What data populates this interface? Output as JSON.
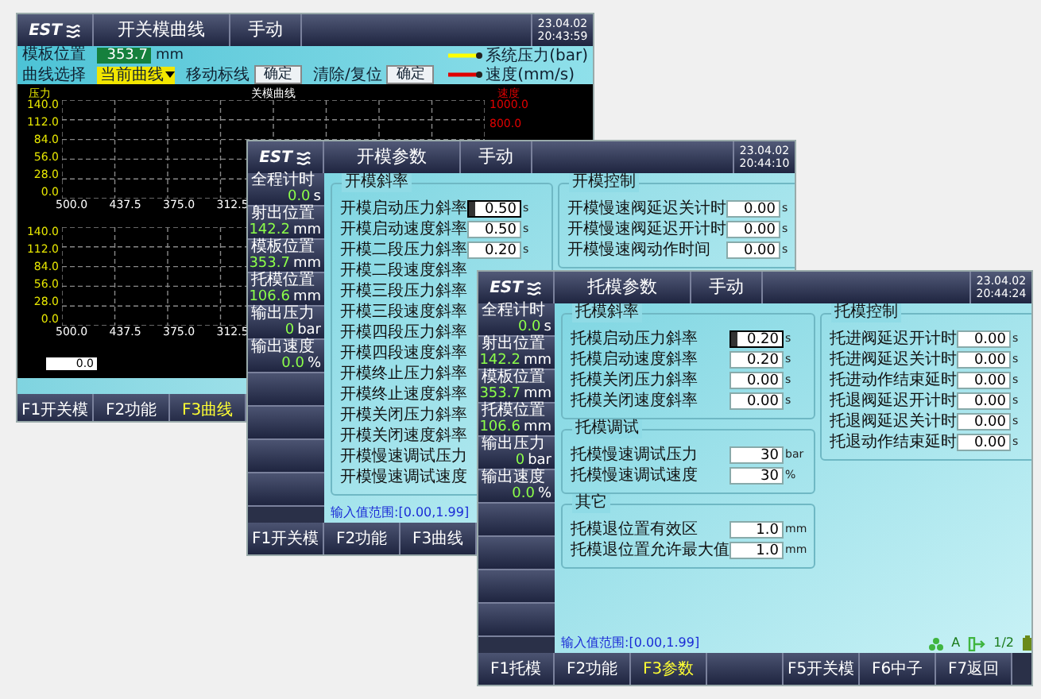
{
  "screens": [
    {
      "kind": "curve",
      "header": {
        "logo": "EST",
        "title": "开关模曲线",
        "mode": "手动",
        "date": "23.04.02",
        "time": "20:43:59"
      },
      "info": {
        "position_label": "模板位置",
        "position_value": "353.7",
        "position_unit": "mm",
        "curve_label": "曲线选择",
        "curve_select": "当前曲线",
        "move_label": "移动标线",
        "move_button": "确定",
        "clear_label": "清除/复位",
        "clear_button": "确定"
      },
      "legend": [
        {
          "label": "系统压力(bar)",
          "color": "#ffff00"
        },
        {
          "label": "速度(mm/s)",
          "color": "#e00000"
        }
      ],
      "charts": [
        {
          "title": "关模曲线",
          "left_axis": "压力",
          "right_axis": "速度",
          "yticks": [
            "140.0",
            "112.0",
            "84.0",
            "56.0",
            "28.0",
            "0.0"
          ],
          "right_ticks": [
            "1000.0",
            "800.0"
          ],
          "xticks": [
            "500.0",
            "437.5",
            "375.0",
            "312.5"
          ]
        },
        {
          "yticks": [
            "140.0",
            "112.0",
            "84.0",
            "56.0",
            "28.0",
            "0.0"
          ],
          "xticks": [
            "500.0",
            "437.5",
            "375.0",
            "312.5"
          ]
        }
      ],
      "cursor_value": "0.0",
      "buttons": [
        {
          "kind": "key",
          "label": "F1开关模",
          "selected": false
        },
        {
          "kind": "key",
          "label": "F2功能",
          "selected": false
        },
        {
          "kind": "key",
          "label": "F3曲线",
          "selected": true
        }
      ]
    },
    {
      "kind": "params",
      "header": {
        "logo": "EST",
        "title": "开模参数",
        "mode": "手动",
        "date": "23.04.02",
        "time": "20:44:10"
      },
      "status": [
        {
          "label": "全程计时",
          "value": "0.0",
          "unit": "s"
        },
        {
          "label": "射出位置",
          "value": "142.2",
          "unit": "mm"
        },
        {
          "label": "模板位置",
          "value": "353.7",
          "unit": "mm"
        },
        {
          "label": "托模位置",
          "value": "106.6",
          "unit": "mm"
        },
        {
          "label": "输出压力",
          "value": "0",
          "unit": "bar"
        },
        {
          "label": "输出速度",
          "value": "0.0",
          "unit": "%"
        }
      ],
      "columns": [
        [
          {
            "title": "开模斜率",
            "rows": [
              {
                "label": "开模启动压力斜率",
                "value": "0.50",
                "unit": "s",
                "focused": true
              },
              {
                "label": "开模启动速度斜率",
                "value": "0.50",
                "unit": "s",
                "focused": false
              },
              {
                "label": "开模二段压力斜率",
                "value": "0.20",
                "unit": "s",
                "focused": false
              },
              {
                "label": "开模二段速度斜率"
              },
              {
                "label": "开模三段压力斜率"
              },
              {
                "label": "开模三段速度斜率"
              },
              {
                "label": "开模四段压力斜率"
              },
              {
                "label": "开模四段速度斜率"
              },
              {
                "label": "开模终止压力斜率"
              },
              {
                "label": "开模终止速度斜率"
              },
              {
                "label": "开模关闭压力斜率"
              },
              {
                "label": "开模关闭速度斜率"
              },
              {
                "label": "开模慢速调试压力"
              },
              {
                "label": "开模慢速调试速度"
              }
            ]
          }
        ],
        [
          {
            "title": "开模控制",
            "rows": [
              {
                "label": "开模慢速阀延迟关计时",
                "value": "0.00",
                "unit": "s",
                "focused": false
              },
              {
                "label": "开模慢速阀延迟开计时",
                "value": "0.00",
                "unit": "s",
                "focused": false
              },
              {
                "label": "开模慢速阀动作时间",
                "value": "0.00",
                "unit": "s",
                "focused": false
              }
            ]
          }
        ]
      ],
      "range": "输入值范围:[0.00,1.99]",
      "buttons": [
        {
          "kind": "key",
          "label": "F1开关模",
          "selected": false
        },
        {
          "kind": "key",
          "label": "F2功能",
          "selected": false
        },
        {
          "kind": "key",
          "label": "F3曲线",
          "selected": false
        }
      ]
    },
    {
      "kind": "params",
      "header": {
        "logo": "EST",
        "title": "托模参数",
        "mode": "手动",
        "date": "23.04.02",
        "time": "20:44:24"
      },
      "status": [
        {
          "label": "全程计时",
          "value": "0.0",
          "unit": "s"
        },
        {
          "label": "射出位置",
          "value": "142.2",
          "unit": "mm"
        },
        {
          "label": "模板位置",
          "value": "353.7",
          "unit": "mm"
        },
        {
          "label": "托模位置",
          "value": "106.6",
          "unit": "mm"
        },
        {
          "label": "输出压力",
          "value": "0",
          "unit": "bar"
        },
        {
          "label": "输出速度",
          "value": "0.0",
          "unit": "%"
        }
      ],
      "columns": [
        [
          {
            "title": "托模斜率",
            "rows": [
              {
                "label": "托模启动压力斜率",
                "value": "0.20",
                "unit": "s",
                "focused": true
              },
              {
                "label": "托模启动速度斜率",
                "value": "0.20",
                "unit": "s",
                "focused": false
              },
              {
                "label": "托模关闭压力斜率",
                "value": "0.00",
                "unit": "s",
                "focused": false
              },
              {
                "label": "托模关闭速度斜率",
                "value": "0.00",
                "unit": "s",
                "focused": false
              }
            ]
          },
          {
            "title": "托模调试",
            "rows": [
              {
                "label": "托模慢速调试压力",
                "value": "30",
                "unit": "bar",
                "focused": false
              },
              {
                "label": "托模慢速调试速度",
                "value": "30",
                "unit": "%",
                "focused": false
              }
            ]
          },
          {
            "title": "其它",
            "rows": [
              {
                "label": "托模退位置有效区",
                "value": "1.0",
                "unit": "mm",
                "focused": false
              },
              {
                "label": "托模退位置允许最大值",
                "value": "1.0",
                "unit": "mm",
                "focused": false
              }
            ]
          }
        ],
        [
          {
            "title": "托模控制",
            "rows": [
              {
                "label": "托进阀延迟开计时",
                "value": "0.00",
                "unit": "s",
                "focused": false
              },
              {
                "label": "托进阀延迟关计时",
                "value": "0.00",
                "unit": "s",
                "focused": false
              },
              {
                "label": "托进动作结束延时",
                "value": "0.00",
                "unit": "s",
                "focused": false
              },
              {
                "label": "托退阀延迟开计时",
                "value": "0.00",
                "unit": "s",
                "focused": false
              },
              {
                "label": "托退阀延迟关计时",
                "value": "0.00",
                "unit": "s",
                "focused": false
              },
              {
                "label": "托退动作结束延时",
                "value": "0.00",
                "unit": "s",
                "focused": false
              }
            ]
          }
        ]
      ],
      "range": "输入值范围:[0.00,1.99]",
      "indicators": {
        "mode": "A",
        "page": "1/2"
      },
      "buttons": [
        {
          "kind": "key",
          "label": "F1托模",
          "selected": false
        },
        {
          "kind": "key",
          "label": "F2功能",
          "selected": false
        },
        {
          "kind": "key",
          "label": "F3参数",
          "selected": true
        },
        {
          "kind": "empty"
        },
        {
          "kind": "key",
          "label": "F5开关模",
          "selected": false
        },
        {
          "kind": "key",
          "label": "F6中子",
          "selected": false
        },
        {
          "kind": "key",
          "label": "F7返回",
          "selected": false
        }
      ]
    }
  ]
}
